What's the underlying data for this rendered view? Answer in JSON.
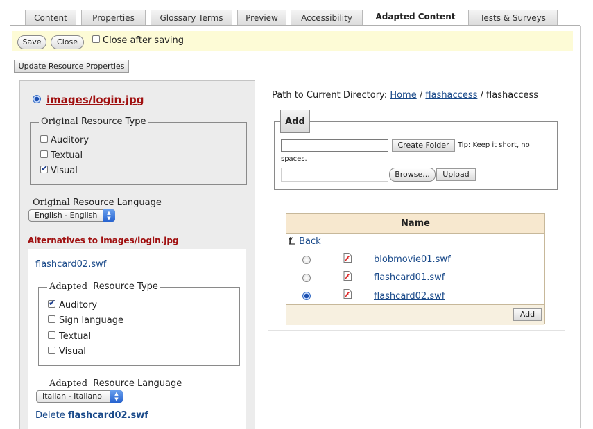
{
  "tabs": [
    {
      "label": "Content",
      "active": false
    },
    {
      "label": "Properties",
      "active": false
    },
    {
      "label": "Glossary Terms",
      "active": false
    },
    {
      "label": "Preview",
      "active": false
    },
    {
      "label": "Accessibility",
      "active": false
    },
    {
      "label": "Adapted Content",
      "active": true
    },
    {
      "label": "Tests & Surveys",
      "active": false
    }
  ],
  "toolbar": {
    "save_label": "Save",
    "close_label": "Close",
    "close_after_saving_label": "Close after saving",
    "close_after_saving_checked": false,
    "update_label": "Update Resource Properties"
  },
  "resource": {
    "title": "images/login.jpg",
    "original_type_legend_prefix": "Original",
    "original_type_legend_rest": "Resource Type",
    "types": [
      {
        "label": "Auditory",
        "checked": false
      },
      {
        "label": "Textual",
        "checked": false
      },
      {
        "label": "Visual",
        "checked": true
      }
    ],
    "language_label_prefix": "Original",
    "language_label_rest": "Resource Language",
    "language_value": "English - English",
    "alternatives_heading": "Alternatives to images/login.jpg"
  },
  "alternative": {
    "file_link": "flashcard02.swf",
    "type_legend_prefix": "Adapted",
    "type_legend_rest": "Resource Type",
    "types": [
      {
        "label": "Auditory",
        "checked": true
      },
      {
        "label": "Sign language",
        "checked": false
      },
      {
        "label": "Textual",
        "checked": false
      },
      {
        "label": "Visual",
        "checked": false
      }
    ],
    "language_label_prefix": "Adapted",
    "language_label_rest": "Resource Language",
    "language_value": "Italian - Italiano",
    "delete_prefix": "Delete",
    "delete_file": "flashcard02.swf"
  },
  "filemanager": {
    "path_label": "Path to Current Directory:",
    "path_home": "Home",
    "path_sep1": "/",
    "path_folder_link": "flashaccess",
    "path_sep2": "/",
    "path_current": "flashaccess",
    "add_legend": "Add",
    "create_folder_label": "Create Folder",
    "tip_line1": "Tip: Keep it short, no",
    "tip_line2": "spaces.",
    "browse_label": "Browse...",
    "upload_label": "Upload",
    "table_header": "Name",
    "back_label": "Back",
    "files": [
      {
        "name": "blobmovie01.swf",
        "selected": false
      },
      {
        "name": "flashcard01.swf",
        "selected": false
      },
      {
        "name": "flashcard02.swf",
        "selected": true
      }
    ],
    "add_button_label": "Add"
  },
  "icons": {
    "file": "flash-file-icon",
    "back": "folder-up-arrow-icon",
    "select_arrows": "select-arrows-icon"
  },
  "colors": {
    "title_red": "#a01010",
    "link_blue": "#1a4a8a",
    "savebar_bg": "#fdfbd6",
    "table_header_bg": "#f7e8cf"
  }
}
